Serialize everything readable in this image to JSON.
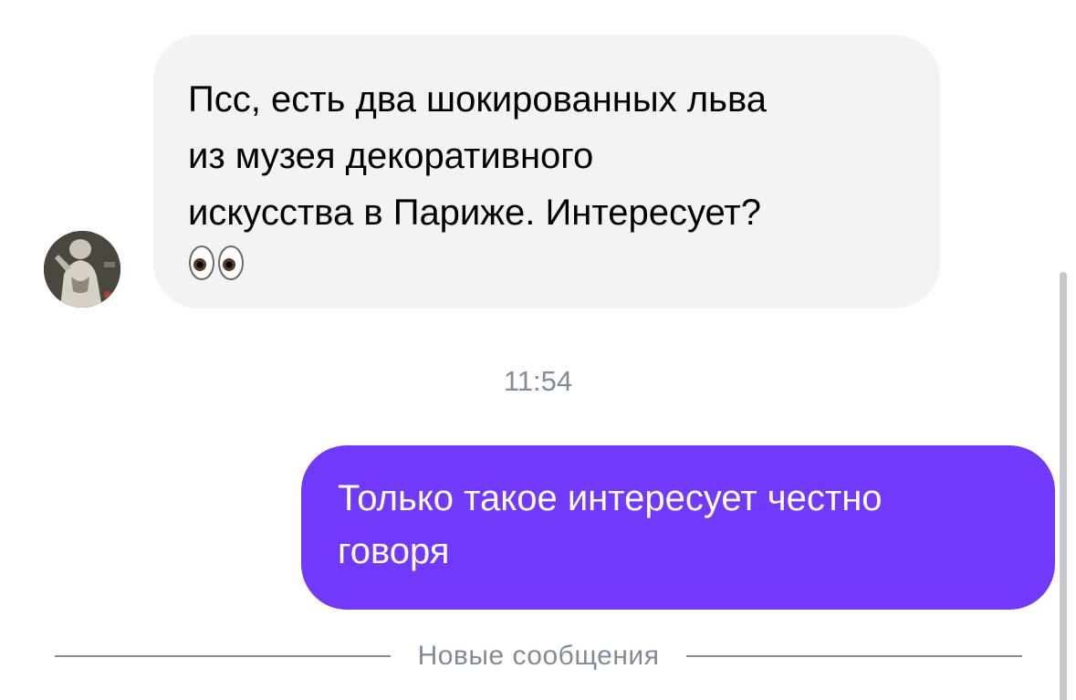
{
  "messages": {
    "incoming": {
      "text": "Псс, есть два шокированных льва\nиз музея декоративного\nискусства в Париже. Интересует?",
      "emoji": "eyes"
    },
    "timestamp": "11:54",
    "outgoing": {
      "text": "Только такое интересует честно\nговоря"
    }
  },
  "divider": {
    "label": "Новые сообщения"
  },
  "colors": {
    "incoming_bubble": "#f2f3f5",
    "outgoing_bubble": "#7339fb",
    "secondary_text": "#818c99"
  },
  "icons": {
    "avatar": "user-avatar-photo",
    "eyes": "eyes-emoji"
  }
}
